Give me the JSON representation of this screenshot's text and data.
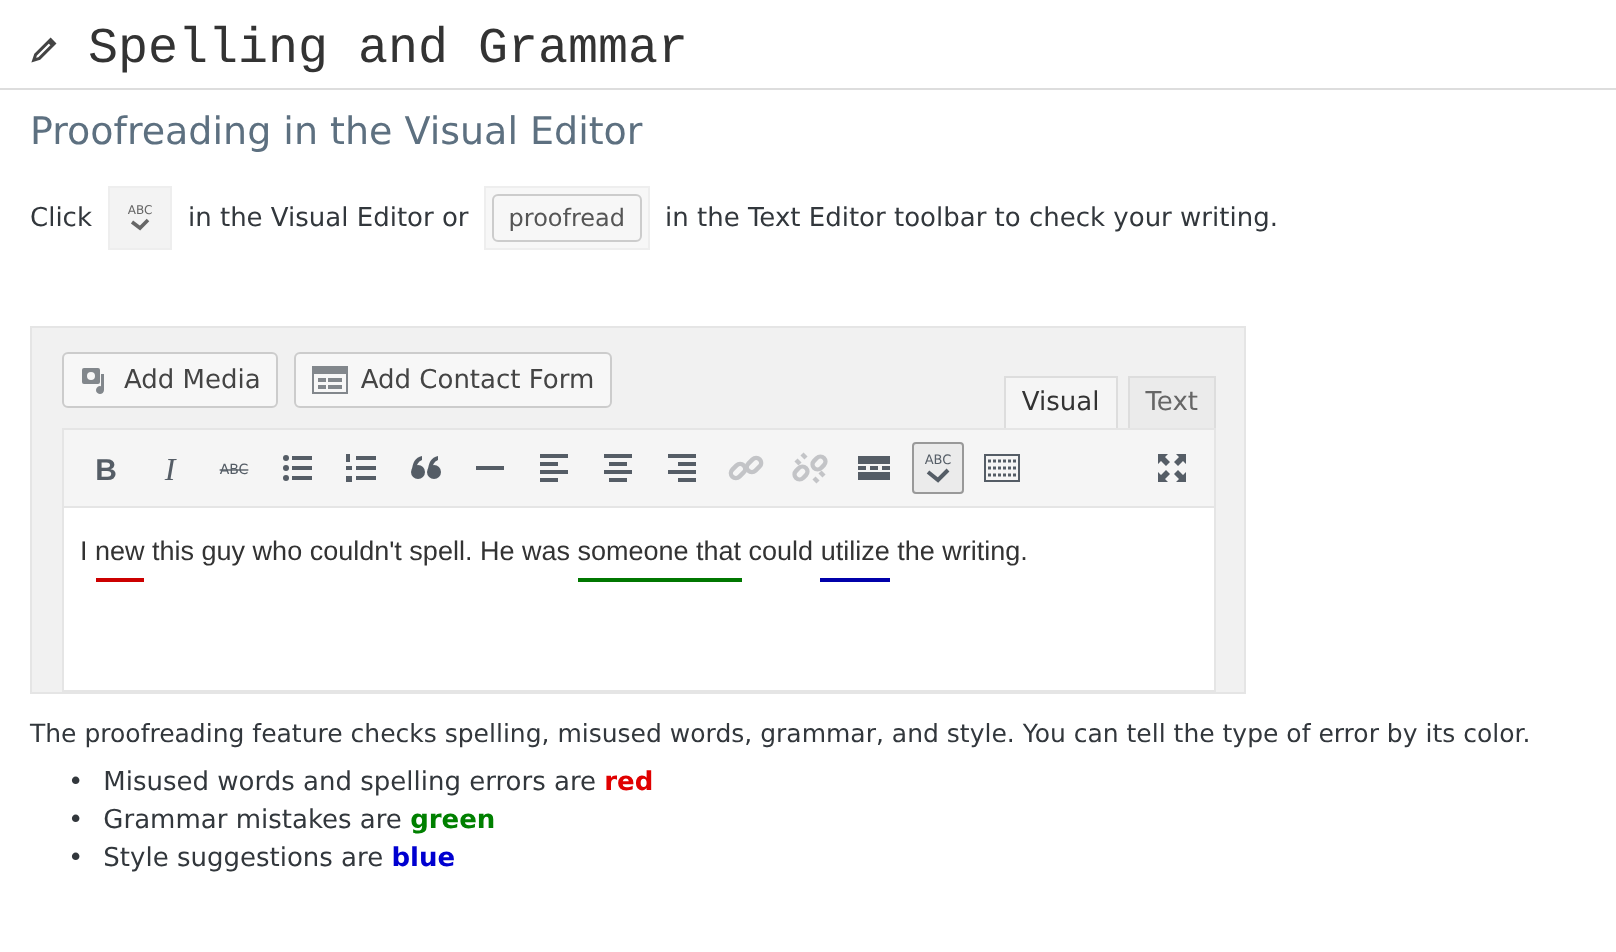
{
  "title": "Spelling and Grammar",
  "subtitle": "Proofreading in the Visual Editor",
  "intro": [
    {
      "kind": "text",
      "text": "Click"
    },
    {
      "kind": "abc-icon",
      "glyph": "ABC"
    },
    {
      "kind": "text",
      "text": "in the Visual Editor or"
    },
    {
      "kind": "button",
      "text": "proofread"
    },
    {
      "kind": "text",
      "text": "in the Text Editor toolbar to check your writing."
    }
  ],
  "editor": {
    "media_buttons": [
      {
        "kind": "media",
        "label": "Add Media"
      },
      {
        "kind": "form",
        "label": "Add Contact Form"
      }
    ],
    "tabs": [
      {
        "label": "Visual",
        "selected": true
      },
      {
        "label": "Text",
        "selected": false
      }
    ],
    "toolbar": [
      {
        "kind": "bold",
        "glyph": "B",
        "selected": false
      },
      {
        "kind": "italic",
        "glyph": "I",
        "selected": false
      },
      {
        "kind": "strike",
        "glyph": "ABC",
        "selected": false
      },
      {
        "kind": "bullets",
        "selected": false
      },
      {
        "kind": "numbers",
        "selected": false
      },
      {
        "kind": "quote",
        "selected": false
      },
      {
        "kind": "hr",
        "selected": false
      },
      {
        "kind": "left",
        "selected": false
      },
      {
        "kind": "center",
        "selected": false
      },
      {
        "kind": "right",
        "selected": false
      },
      {
        "kind": "link",
        "selected": false
      },
      {
        "kind": "unlink",
        "selected": false
      },
      {
        "kind": "more",
        "selected": false
      },
      {
        "kind": "proofread",
        "glyph": "ABC",
        "selected": true
      },
      {
        "kind": "keyboard",
        "selected": false
      },
      {
        "kind": "fullscreen",
        "selected": false
      }
    ],
    "content": [
      {
        "text": "I "
      },
      {
        "text": "new",
        "color": "#cc0000"
      },
      {
        "text": " this guy who couldn't spell. He was "
      },
      {
        "text": "someone that",
        "color": "#007700"
      },
      {
        "text": " could "
      },
      {
        "text": "utilize",
        "color": "#0000aa"
      },
      {
        "text": " the writing."
      }
    ]
  },
  "explanation": "The proofreading feature checks spelling, misused words, grammar, and style. You can tell the type of error by its color.",
  "legend": [
    {
      "marker": "•",
      "text": "Misused words and spelling errors are ",
      "word": "red",
      "color": "#e00000"
    },
    {
      "marker": "•",
      "text": "Grammar mistakes are ",
      "word": "green",
      "color": "#008000"
    },
    {
      "marker": "•",
      "text": "Style suggestions are ",
      "word": "blue",
      "color": "#0000d0"
    }
  ]
}
